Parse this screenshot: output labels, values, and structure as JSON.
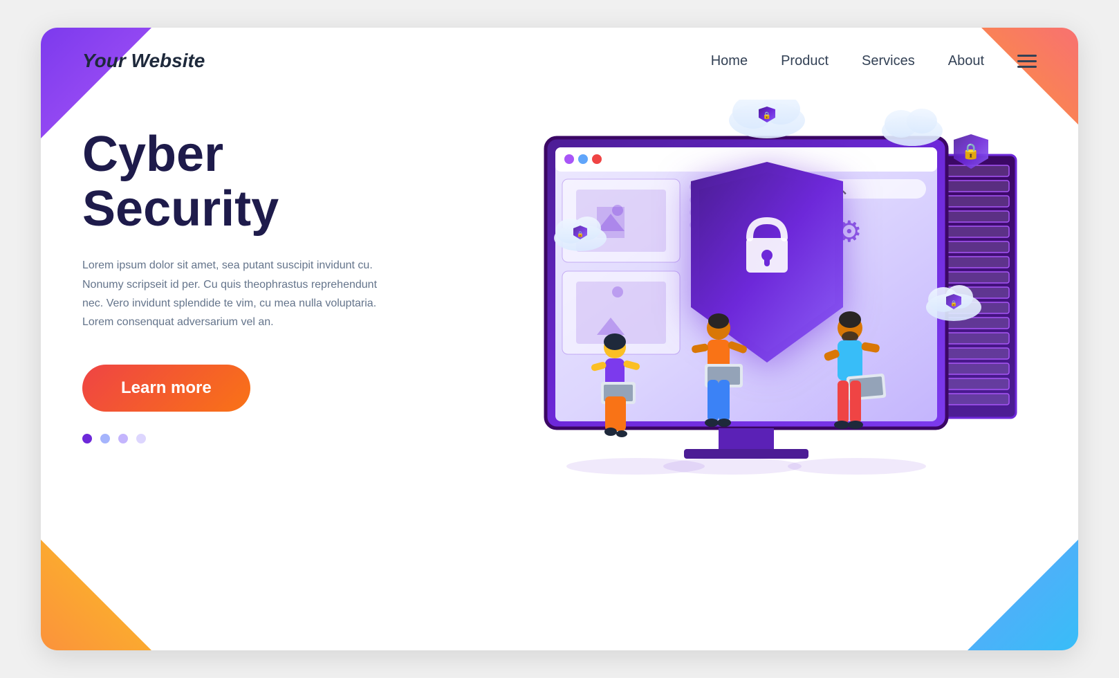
{
  "header": {
    "logo": "Your Website",
    "nav": {
      "home": "Home",
      "product": "Product",
      "services": "Services",
      "about": "About"
    }
  },
  "hero": {
    "title_line1": "Cyber",
    "title_line2": "Security",
    "description": "Lorem ipsum dolor sit amet, sea putant suscipit invidunt cu. Nonumy scripseit id per. Cu quis theophrastus reprehendunt nec. Vero invidunt splendide te vim, cu mea nulla voluptaria. Lorem consenquat adversarium vel an.",
    "cta_button": "Learn more"
  },
  "dots": {
    "active": "●",
    "inactive": "●"
  },
  "illustration": {
    "shield_icon": "🔒",
    "cloud_icon": "☁",
    "lock_icon": "🔒",
    "gear_icon": "⚙"
  }
}
